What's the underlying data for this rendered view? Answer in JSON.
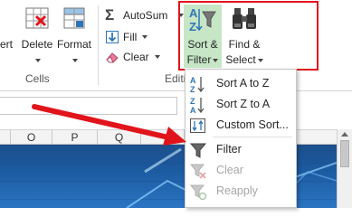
{
  "ribbon": {
    "cells_group": {
      "insert_label": "ert",
      "delete_label": "Delete",
      "format_label": "Format",
      "group_label": "Cells"
    },
    "editing_group": {
      "autosum_label": "AutoSum",
      "fill_label": "Fill",
      "clear_label": "Clear",
      "sort_filter_line1": "Sort &",
      "sort_filter_line2": "Filter",
      "find_select_line1": "Find &",
      "find_select_line2": "Select",
      "group_label": "Editi"
    }
  },
  "column_headers": [
    "O",
    "P",
    "Q"
  ],
  "sort_filter_menu": {
    "items": [
      {
        "label": "Sort A to Z",
        "icon": "sort-a-to-z-icon",
        "enabled": true
      },
      {
        "label": "Sort Z to A",
        "icon": "sort-z-to-a-icon",
        "enabled": true
      },
      {
        "label": "Custom Sort...",
        "icon": "custom-sort-icon",
        "enabled": true
      },
      {
        "label": "Filter",
        "icon": "filter-icon",
        "enabled": true
      },
      {
        "label": "Clear",
        "icon": "clear-filter-icon",
        "enabled": false
      },
      {
        "label": "Reapply",
        "icon": "reapply-filter-icon",
        "enabled": false
      }
    ]
  },
  "colors": {
    "highlight_box": "#e2141b",
    "annotation_arrow": "#e2141b",
    "sort_button_active": "#c6e6c6",
    "sheet_background": "#1d4f8c"
  }
}
